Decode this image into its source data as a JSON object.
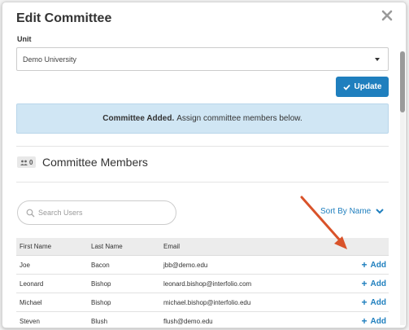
{
  "modal": {
    "title": "Edit Committee",
    "close_icon": "close-icon"
  },
  "unit": {
    "label": "Unit",
    "selected": "Demo University"
  },
  "update_button": {
    "label": "Update",
    "icon": "check-icon"
  },
  "alert": {
    "strong": "Committee Added.",
    "message": "Assign committee members below."
  },
  "members": {
    "count": "0",
    "title": "Committee Members"
  },
  "search": {
    "placeholder": "Search Users"
  },
  "sort": {
    "label": "Sort By Name"
  },
  "table": {
    "headers": [
      "First Name",
      "Last Name",
      "Email"
    ],
    "add_label": "Add",
    "rows": [
      {
        "first": "Joe",
        "last": "Bacon",
        "email": "jbb@demo.edu"
      },
      {
        "first": "Leonard",
        "last": "Bishop",
        "email": "leonard.bishop@interfolio.com"
      },
      {
        "first": "Michael",
        "last": "Bishop",
        "email": "michael.bishop@interfolio.edu"
      },
      {
        "first": "Steven",
        "last": "Blush",
        "email": "flush@demo.edu"
      }
    ]
  },
  "colors": {
    "accent": "#1f7fbe",
    "alert_bg": "#d0e6f4",
    "annotation_arrow": "#d9532a"
  }
}
